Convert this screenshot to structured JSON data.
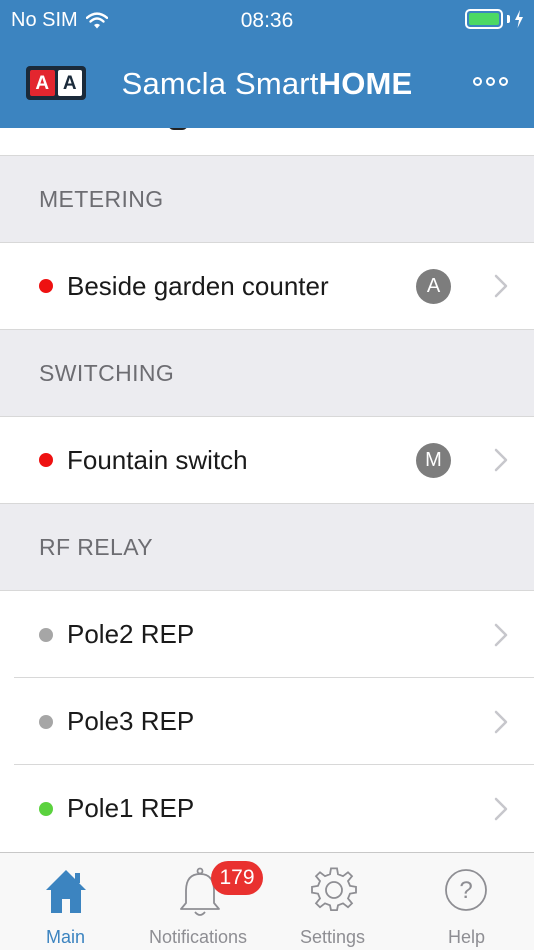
{
  "status": {
    "carrier": "No SIM",
    "time": "08:36",
    "battery_color": "#4cd964"
  },
  "header": {
    "logo_letters": [
      "A",
      "A"
    ],
    "title_regular": "Samcla Smart",
    "title_bold": "HOME",
    "more_icon": "more-icon",
    "background": "#3c84c0"
  },
  "sections": [
    {
      "title": "METERING",
      "items": [
        {
          "label": "Beside garden counter",
          "status_color": "#ee1111",
          "mode": "A"
        }
      ]
    },
    {
      "title": "SWITCHING",
      "items": [
        {
          "label": "Fountain switch",
          "status_color": "#ee1111",
          "mode": "M"
        }
      ]
    },
    {
      "title": "RF RELAY",
      "items": [
        {
          "label": "Pole2 REP",
          "status_color": "#a6a6a6"
        },
        {
          "label": "Pole3 REP",
          "status_color": "#a6a6a6"
        },
        {
          "label": "Pole1 REP",
          "status_color": "#5bd23e"
        }
      ]
    }
  ],
  "tabs": [
    {
      "label": "Main",
      "icon": "home-icon",
      "active": true
    },
    {
      "label": "Notifications",
      "icon": "bell-icon",
      "badge": "179"
    },
    {
      "label": "Settings",
      "icon": "gear-icon"
    },
    {
      "label": "Help",
      "icon": "help-icon"
    }
  ],
  "accent_color": "#3c84c0",
  "badge_color": "#e9312f"
}
